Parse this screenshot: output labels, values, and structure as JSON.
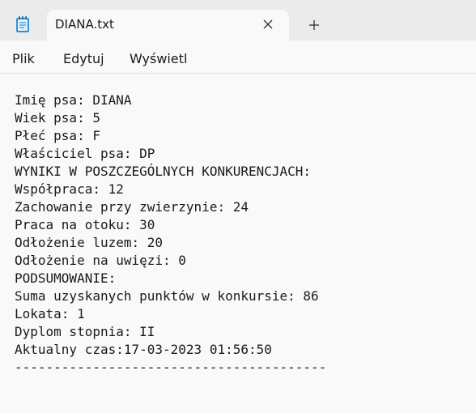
{
  "window": {
    "tab_title": "DIANA.txt"
  },
  "menu": {
    "file": "Plik",
    "edit": "Edytuj",
    "view": "Wyświetl"
  },
  "document": {
    "lines": [
      "Imię psa: DIANA",
      "Wiek psa: 5",
      "Płeć psa: F",
      "Właściciel psa: DP",
      "WYNIKI W POSZCZEGÓLNYCH KONKURENCJACH:",
      "Współpraca: 12",
      "Zachowanie przy zwierzynie: 24",
      "Praca na otoku: 30",
      "Odłożenie luzem: 20",
      "Odłożenie na uwięzi: 0",
      "PODSUMOWANIE:",
      "Suma uzyskanych punktów w konkursie: 86",
      "Lokata: 1",
      "Dyplom stopnia: II",
      "Aktualny czas:17-03-2023 01:56:50",
      "----------------------------------------"
    ]
  },
  "icons": {
    "app": "notepad-icon",
    "close": "close-icon",
    "new_tab": "plus-icon"
  },
  "colors": {
    "titlebar": "#ebebeb",
    "background": "#f9f9f9",
    "text": "#1a1a1a",
    "app_icon_accent": "#3a8fd1"
  }
}
